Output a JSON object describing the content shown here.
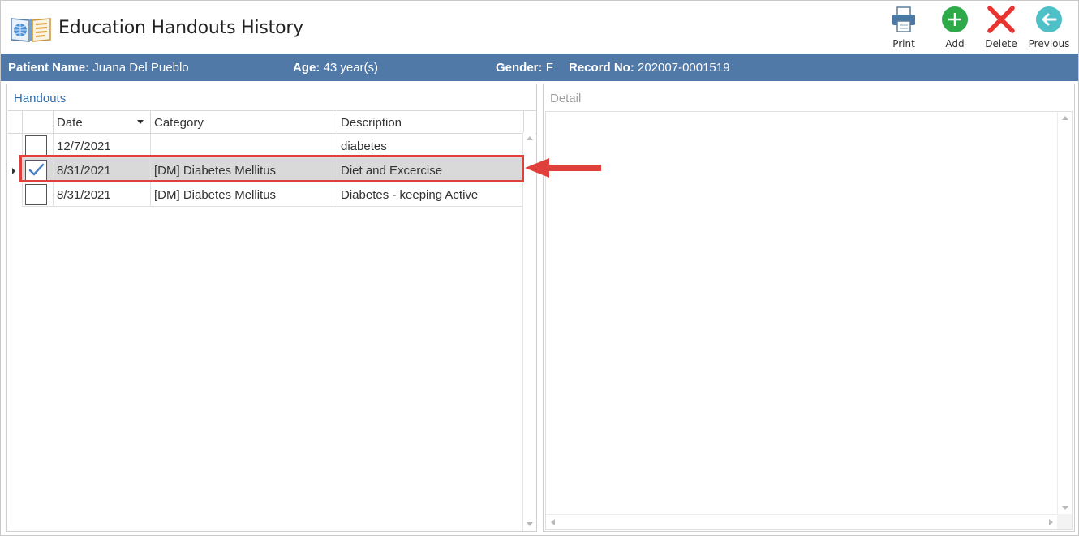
{
  "window": {
    "title": "Education Handouts History"
  },
  "toolbar": {
    "print_label": "Print",
    "add_label": "Add",
    "delete_label": "Delete",
    "previous_label": "Previous"
  },
  "patient": {
    "name_label": "Patient Name:",
    "name": "Juana Del Pueblo",
    "age_label": "Age:",
    "age": "43 year(s)",
    "gender_label": "Gender:",
    "gender": "F",
    "record_label": "Record No:",
    "record_no": "202007-0001519"
  },
  "handouts": {
    "title": "Handouts",
    "columns": {
      "date": "Date",
      "category": "Category",
      "description": "Description"
    },
    "sort_column": "Date",
    "rows": [
      {
        "checked": false,
        "selected": false,
        "date": "12/7/2021",
        "category": "",
        "description": "diabetes"
      },
      {
        "checked": true,
        "selected": true,
        "date": "8/31/2021",
        "category": "[DM] Diabetes Mellitus",
        "description": "Diet and Excercise"
      },
      {
        "checked": false,
        "selected": false,
        "date": "8/31/2021",
        "category": "[DM] Diabetes Mellitus",
        "description": "Diabetes - keeping Active"
      }
    ]
  },
  "detail": {
    "title": "Detail",
    "content": ""
  },
  "colors": {
    "patient_bar": "#5079a8",
    "selection": "#d9d9d9",
    "highlight": "#e0403c",
    "add_green": "#2eaa4a",
    "delete_red": "#e8332f",
    "previous_teal": "#4fc0c7"
  }
}
